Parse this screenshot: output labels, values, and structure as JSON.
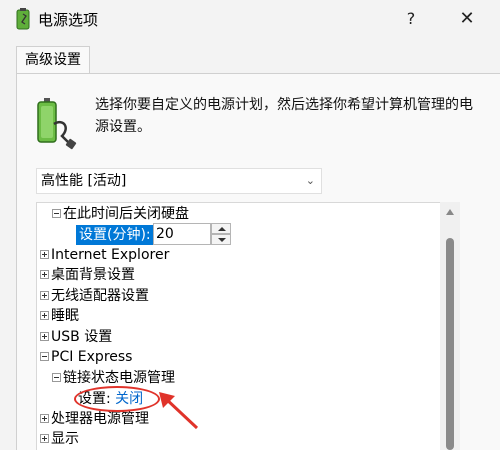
{
  "window": {
    "title": "电源选项",
    "help_label": "?",
    "close_label": "✕",
    "icon": "power-options-icon"
  },
  "tabs": [
    {
      "label": "高级设置",
      "active": true
    }
  ],
  "description": "选择你要自定义的电源计划，然后选择你希望计算机管理的电源设置。",
  "plan_select": {
    "value": "高性能 [活动]",
    "chevron": "⌄"
  },
  "tree": {
    "hard_disk": {
      "label": "在此时间后关闭硬盘",
      "expanded": true
    },
    "hard_disk_setting": {
      "label": "设置(分钟):",
      "value": "20"
    },
    "items": [
      {
        "label": "Internet Explorer",
        "expanded": false
      },
      {
        "label": "桌面背景设置",
        "expanded": false
      },
      {
        "label": "无线适配器设置",
        "expanded": false
      },
      {
        "label": "睡眠",
        "expanded": false
      },
      {
        "label": "USB 设置",
        "expanded": false
      }
    ],
    "pci": {
      "label": "PCI Express",
      "expanded": true
    },
    "link_state": {
      "label": "链接状态电源管理",
      "expanded": true
    },
    "link_state_setting": {
      "label": "设置:",
      "value": "关闭"
    },
    "processor": {
      "label": "处理器电源管理",
      "expanded": false
    },
    "display": {
      "label": "显示",
      "expanded": false
    }
  },
  "colors": {
    "selection": "#0078d7",
    "link": "#0066cc",
    "annotation": "#e0332a"
  }
}
